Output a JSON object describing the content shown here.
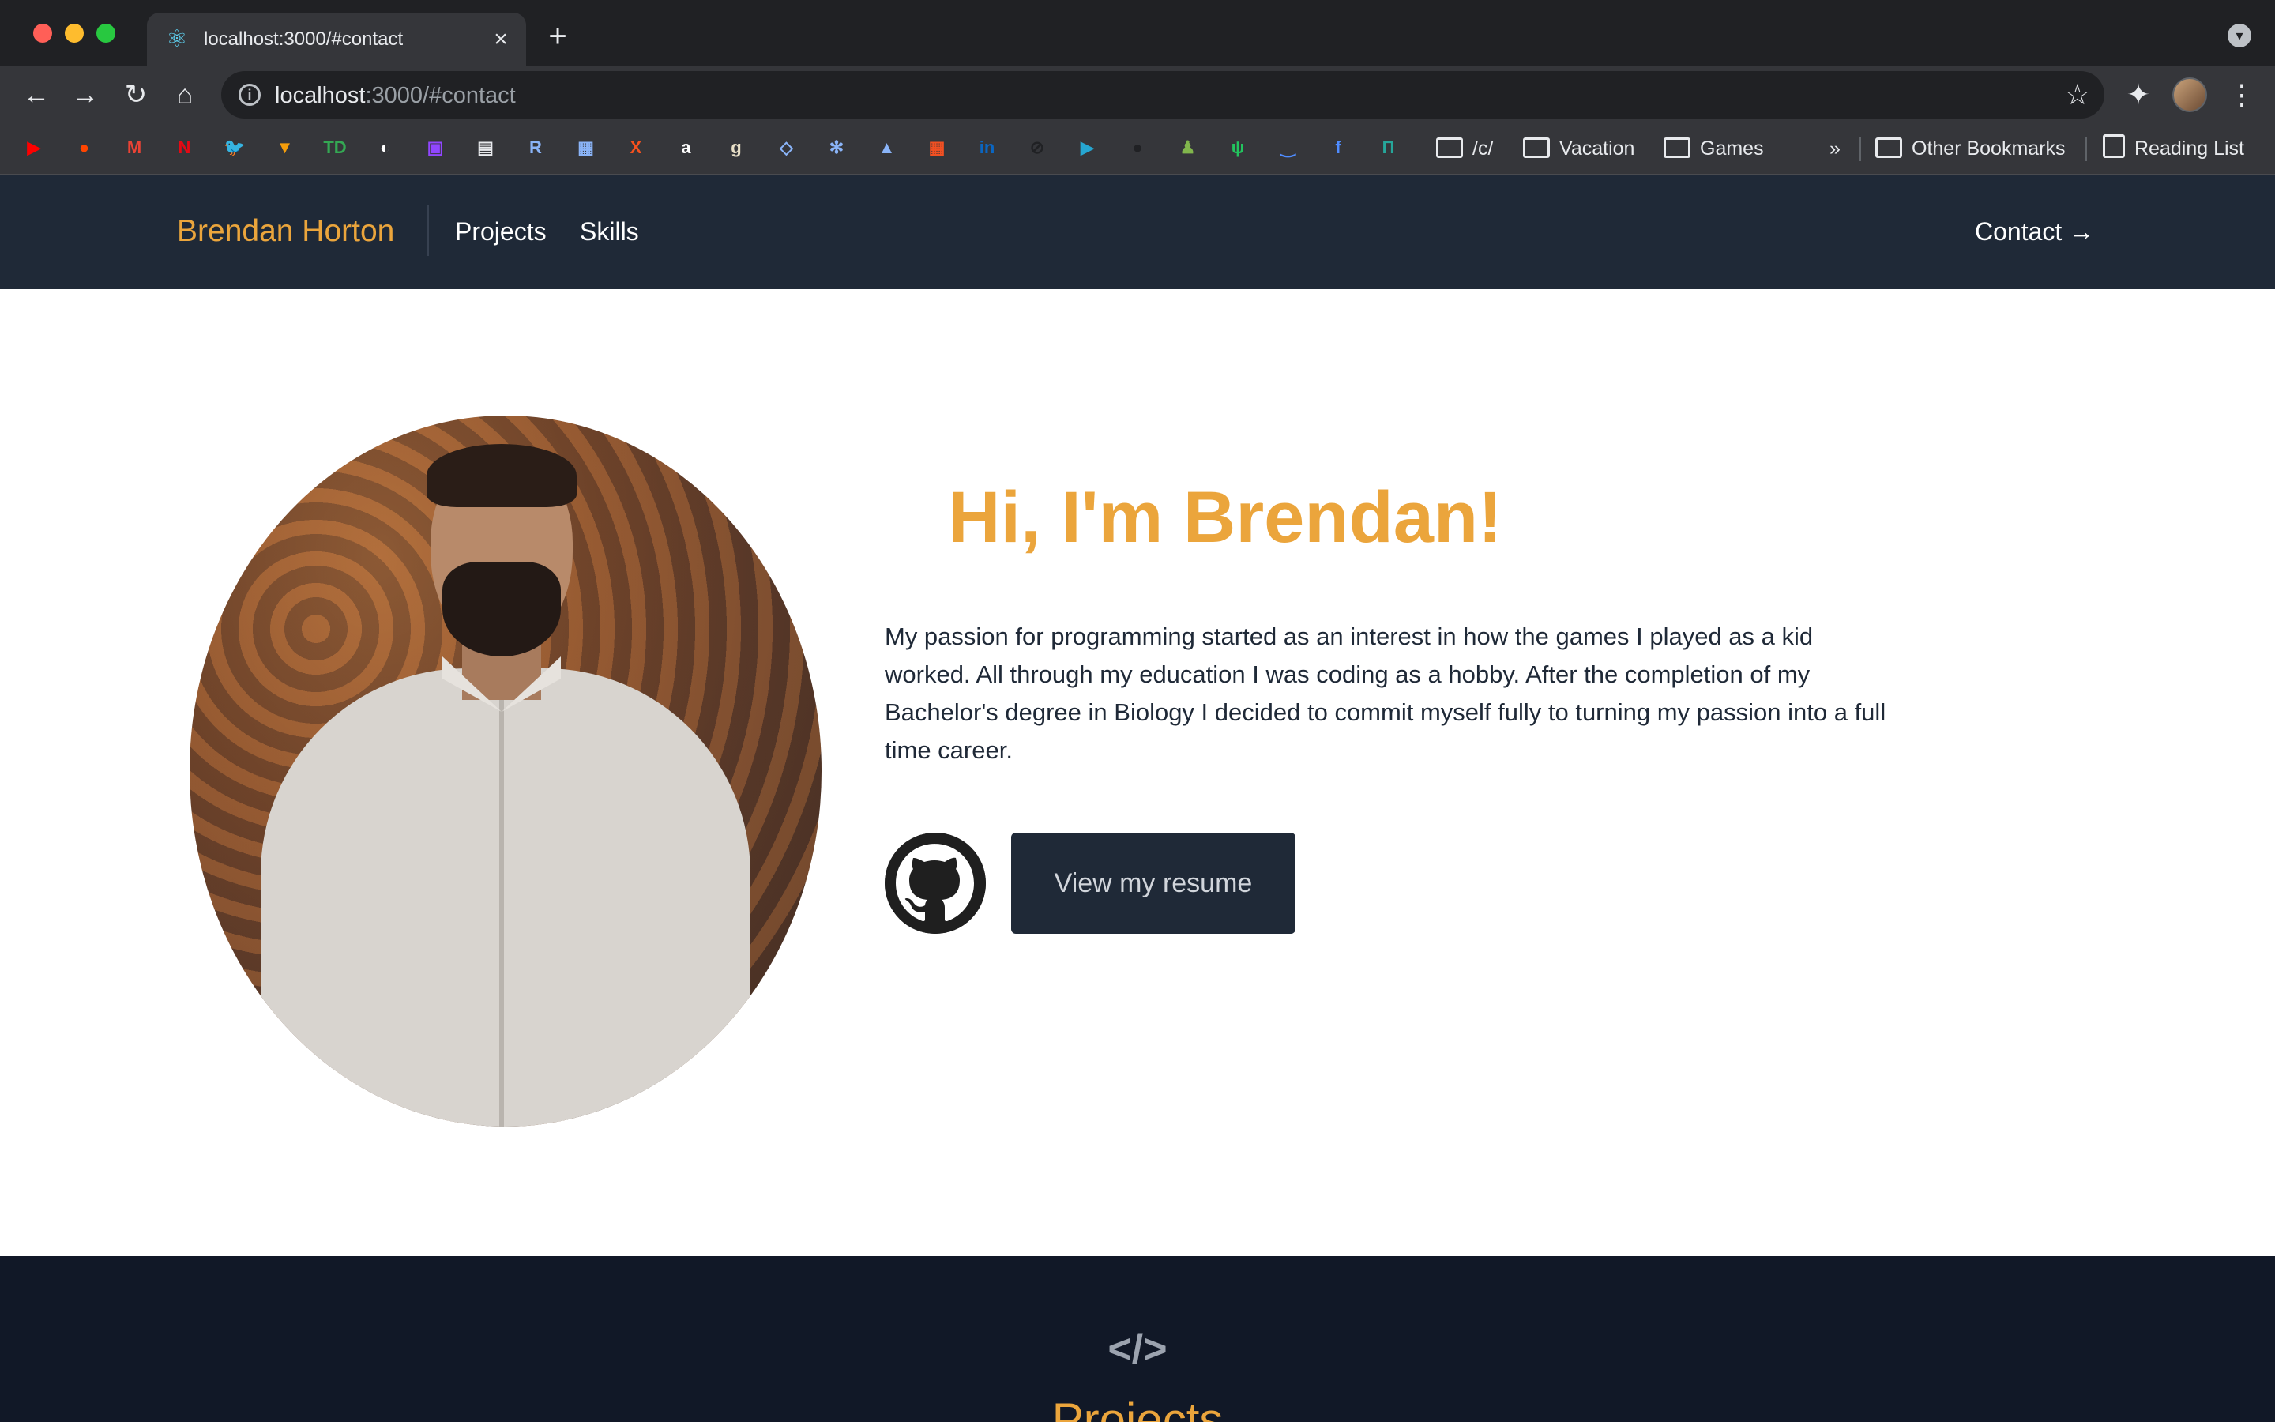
{
  "browser": {
    "tab_title": "localhost:3000/#contact",
    "tab_favicon": "react-icon",
    "url_host": "localhost",
    "url_rest": ":3000/#contact",
    "bookmarks": [
      {
        "icon": "youtube-icon",
        "glyph": "▶",
        "color": "#ff0000"
      },
      {
        "icon": "reddit-icon",
        "glyph": "●",
        "color": "#ff4500"
      },
      {
        "icon": "gmail-icon",
        "glyph": "M",
        "color": "#ea4335"
      },
      {
        "icon": "netflix-icon",
        "glyph": "N",
        "color": "#e50914"
      },
      {
        "icon": "twitter-icon",
        "glyph": "🐦",
        "color": "#1da1f2"
      },
      {
        "icon": "funnel-icon",
        "glyph": "▼",
        "color": "#f59e0b"
      },
      {
        "icon": "td-bank-icon",
        "glyph": "TD",
        "color": "#34a853"
      },
      {
        "icon": "app-circle-icon",
        "glyph": "◐",
        "color": "#ffffff"
      },
      {
        "icon": "twitch-icon",
        "glyph": "▣",
        "color": "#9146ff"
      },
      {
        "icon": "terminal-icon",
        "glyph": "▤",
        "color": "#e8eaed"
      },
      {
        "icon": "r-icon",
        "glyph": "R",
        "color": "#8ab4f8"
      },
      {
        "icon": "scroll-icon",
        "glyph": "▦",
        "color": "#8ab4f8"
      },
      {
        "icon": "x-icon",
        "glyph": "X",
        "color": "#f4511e"
      },
      {
        "icon": "amazon-icon",
        "glyph": "a",
        "color": "#ffffff"
      },
      {
        "icon": "goodreads-icon",
        "glyph": "g",
        "color": "#e9e0c8"
      },
      {
        "icon": "vector-icon",
        "glyph": "◇",
        "color": "#8ab4f8"
      },
      {
        "icon": "atom-icon",
        "glyph": "✻",
        "color": "#8ab4f8"
      },
      {
        "icon": "graduation-cap-icon",
        "glyph": "▲",
        "color": "#8ab4f8"
      },
      {
        "icon": "microsoft-icon",
        "glyph": "▦",
        "color": "#f25022"
      },
      {
        "icon": "linkedin-icon",
        "glyph": "in",
        "color": "#0a66c2"
      },
      {
        "icon": "slash-circle-icon",
        "glyph": "⊘",
        "color": "#202124"
      },
      {
        "icon": "play-circle-icon",
        "glyph": "▶",
        "color": "#26a6d1"
      },
      {
        "icon": "github-icon",
        "glyph": "●",
        "color": "#202124"
      },
      {
        "icon": "chess-pawn-icon",
        "glyph": "♟",
        "color": "#81b64c"
      },
      {
        "icon": "cactus-icon",
        "glyph": "ψ",
        "color": "#22c55e"
      },
      {
        "icon": "smile-icon",
        "glyph": "‿",
        "color": "#4f8cff"
      },
      {
        "icon": "f-circle-icon",
        "glyph": "f",
        "color": "#4f8cff"
      },
      {
        "icon": "n-square-icon",
        "glyph": "П",
        "color": "#26a69a"
      }
    ],
    "bookmark_folders": [
      "/c/",
      "Vacation",
      "Games"
    ],
    "overflow": "»",
    "other_bookmarks": "Other Bookmarks",
    "reading_list": "Reading List"
  },
  "site": {
    "brand": "Brendan Horton",
    "nav": [
      "Projects",
      "Skills"
    ],
    "contact": "Contact →",
    "hero": {
      "title": "Hi, I'm Brendan!",
      "text": "My passion for programming started as an interest in how the games I played as a kid worked. All through my education I was coding as a hobby. After the completion of my Bachelor's degree in Biology I decided to commit myself fully to turning my passion into a full time career.",
      "resume_button": "View my resume"
    },
    "footer_icon": "</>",
    "next_heading_peek": "Projects"
  },
  "colors": {
    "accent": "#eba53c",
    "nav_bg": "#1f2937",
    "footer_bg": "#111827"
  }
}
